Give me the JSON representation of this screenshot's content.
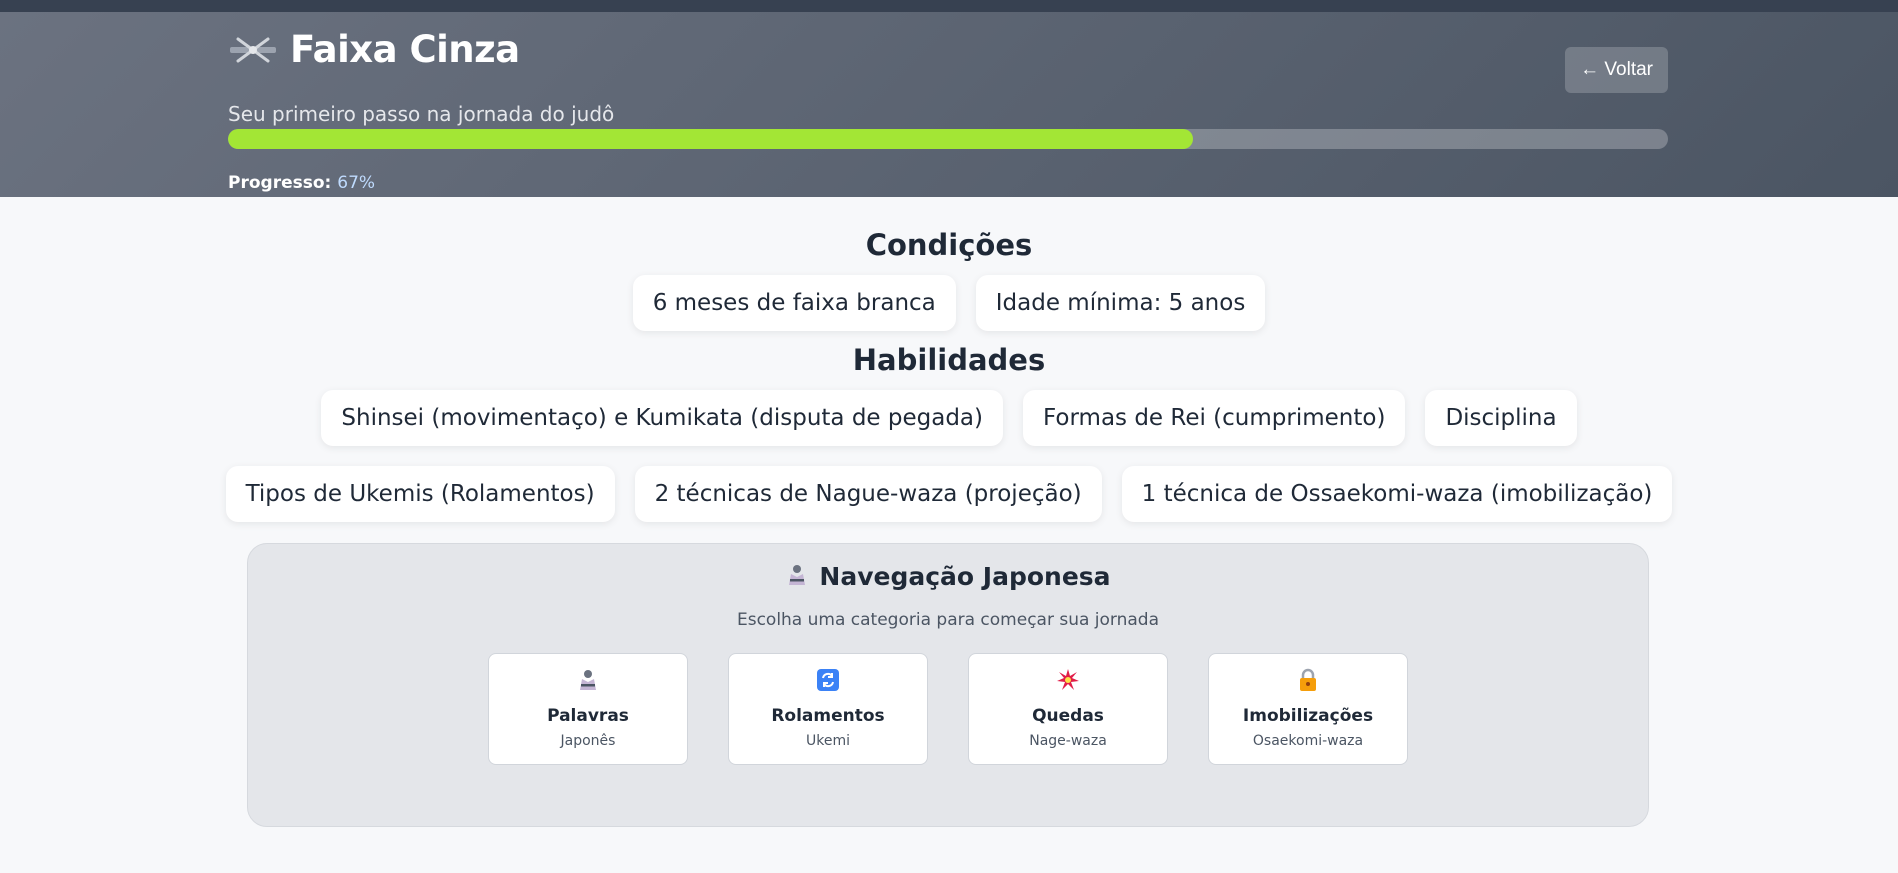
{
  "header": {
    "title": "Faixa Cinza",
    "subtitle": "Seu primeiro passo na jornada do judô",
    "back_label": "← Voltar",
    "progress_label": "Progresso:",
    "progress_value_text": "67%",
    "progress_fraction": 0.67,
    "progress_color": "#a3e635"
  },
  "conditions": {
    "title": "Condições",
    "items": [
      "6 meses de faixa branca",
      "Idade mínima: 5 anos"
    ]
  },
  "skills": {
    "title": "Habilidades",
    "row1": [
      "Shinsei (movimentaço) e Kumikata (disputa de pegada)",
      "Formas de Rei (cumprimento)",
      "Disciplina"
    ],
    "row2": [
      "Tipos de Ukemis (Rolamentos)",
      "2 técnicas de Nague-waza (projeção)",
      "1 técnica de Ossaekomi-waza (imobilização)"
    ]
  },
  "navigation": {
    "icon": "judoka-icon",
    "title": "Navegação Japonesa",
    "subtitle": "Escolha uma categoria para começar sua jornada",
    "cards": [
      {
        "icon": "judoka-icon",
        "title": "Palavras",
        "subtitle": "Japonês"
      },
      {
        "icon": "refresh-icon",
        "title": "Rolamentos",
        "subtitle": "Ukemi"
      },
      {
        "icon": "burst-icon",
        "title": "Quedas",
        "subtitle": "Nage-waza"
      },
      {
        "icon": "lock-icon",
        "title": "Imobilizações",
        "subtitle": "Osaekomi-waza"
      }
    ]
  }
}
